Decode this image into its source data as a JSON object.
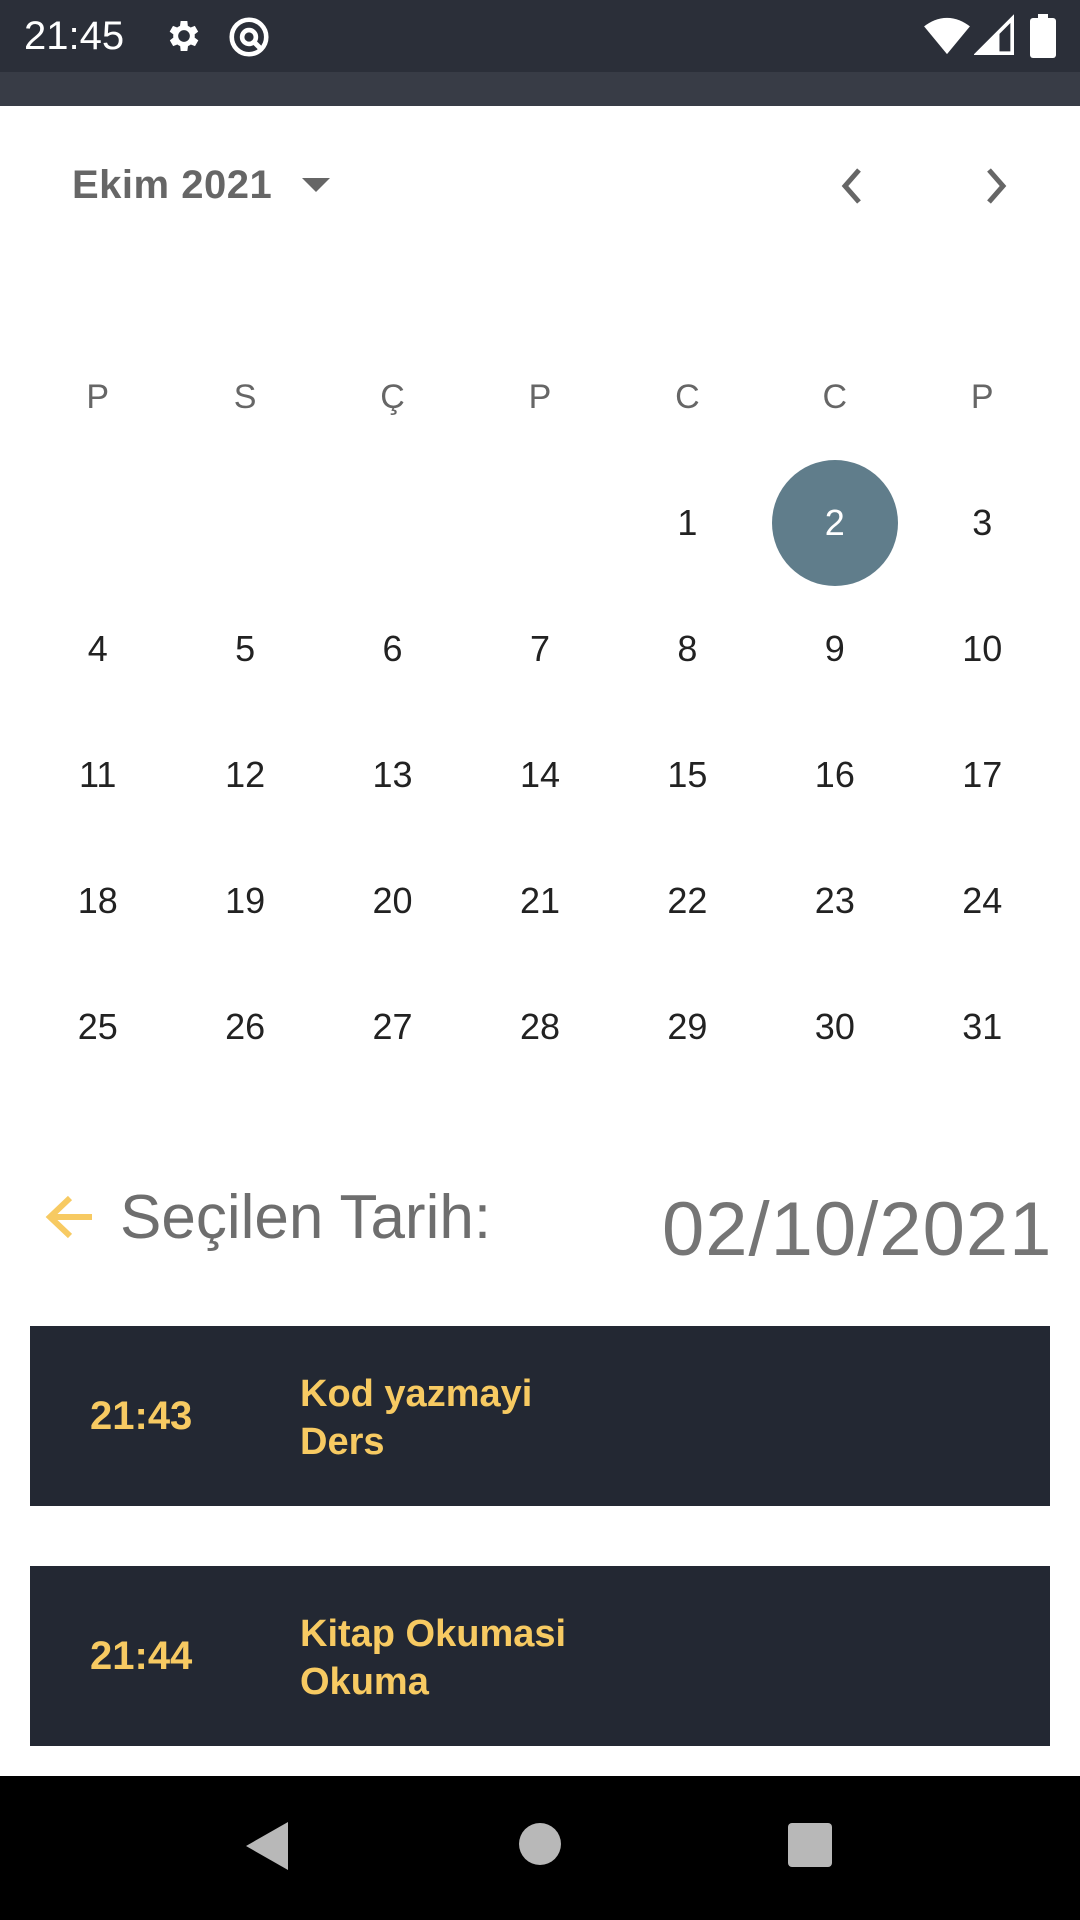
{
  "status_bar": {
    "time": "21:45",
    "icons_left": [
      "gear-icon",
      "no-disturb-icon"
    ],
    "icons_right": [
      "wifi-icon",
      "signal-icon",
      "battery-icon"
    ]
  },
  "calendar": {
    "month_label": "Ekim 2021",
    "weekdays": [
      "P",
      "S",
      "Ç",
      "P",
      "C",
      "C",
      "P"
    ],
    "weeks": [
      [
        "",
        "",
        "",
        "",
        "1",
        "2",
        "3"
      ],
      [
        "4",
        "5",
        "6",
        "7",
        "8",
        "9",
        "10"
      ],
      [
        "11",
        "12",
        "13",
        "14",
        "15",
        "16",
        "17"
      ],
      [
        "18",
        "19",
        "20",
        "21",
        "22",
        "23",
        "24"
      ],
      [
        "25",
        "26",
        "27",
        "28",
        "29",
        "30",
        "31"
      ]
    ],
    "selected_day": "2",
    "selected_color": "#607d8b"
  },
  "selection": {
    "label": "Seçilen Tarih:",
    "date": "02/10/2021"
  },
  "events": [
    {
      "time": "21:43",
      "title": "Kod yazmayi",
      "subtitle": "Ders"
    },
    {
      "time": "21:44",
      "title": "Kitap Okumasi",
      "subtitle": "Okuma"
    }
  ],
  "colors": {
    "accent": "#f7ca62",
    "card_bg": "#232833",
    "status_bar": "#2b2f39"
  }
}
